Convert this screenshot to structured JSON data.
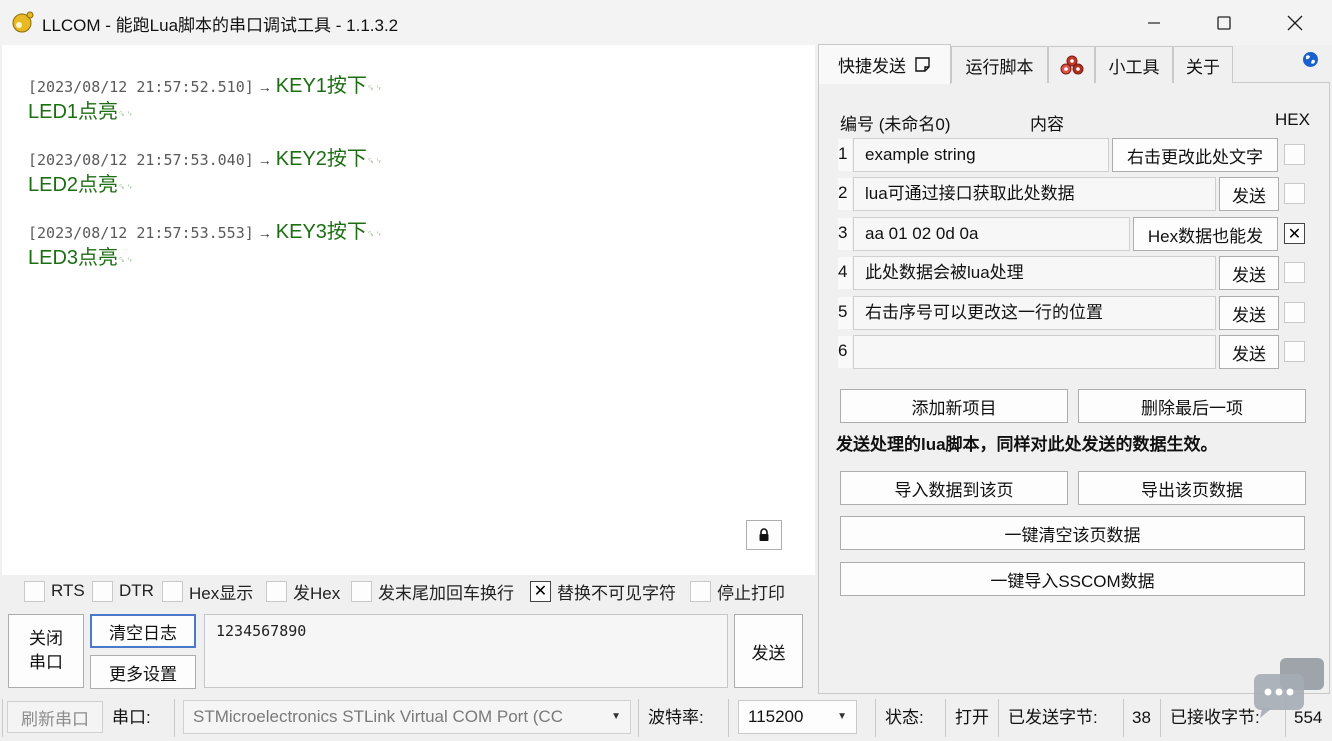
{
  "window": {
    "title": "LLCOM - 能跑Lua脚本的串口调试工具 - 1.1.3.2",
    "minimize_icon": "minimize-icon",
    "maximize_icon": "maximize-icon",
    "close_icon": "close-icon"
  },
  "log": {
    "crlf_marker": "␍␊",
    "arrow": "→",
    "entries": [
      {
        "timestamp": "[2023/08/12 21:57:52.510]",
        "line1": "KEY1按下",
        "line2": "LED1点亮"
      },
      {
        "timestamp": "[2023/08/12 21:57:53.040]",
        "line1": "KEY2按下",
        "line2": "LED2点亮"
      },
      {
        "timestamp": "[2023/08/12 21:57:53.553]",
        "line1": "KEY3按下",
        "line2": "LED3点亮"
      }
    ]
  },
  "options": [
    {
      "label": "RTS",
      "checked": false
    },
    {
      "label": "DTR",
      "checked": false
    },
    {
      "label": "Hex显示",
      "checked": false
    },
    {
      "label": "发Hex",
      "checked": false
    },
    {
      "label": "发末尾加回车换行",
      "checked": false
    },
    {
      "label": "替换不可见字符",
      "checked": true
    },
    {
      "label": "停止打印",
      "checked": false
    }
  ],
  "controls": {
    "close_port": "关闭\n串口",
    "clear_log": "清空日志",
    "more_settings": "更多设置",
    "send_text": "1234567890",
    "send": "发送"
  },
  "tabs": [
    {
      "label": "快捷发送",
      "active": true
    },
    {
      "label": "运行脚本",
      "active": false
    },
    {
      "label": "",
      "icon": "cubes-icon",
      "active": false
    },
    {
      "label": "小工具",
      "active": false
    },
    {
      "label": "关于",
      "active": false
    }
  ],
  "quick_send": {
    "header_num": "编号 (未命名0)",
    "header_content": "内容",
    "header_hex": "HEX",
    "rows": [
      {
        "num": "1",
        "content": "example string",
        "button": "右击更改此处文字",
        "hex": false
      },
      {
        "num": "2",
        "content": "lua可通过接口获取此处数据",
        "button": "发送",
        "hex": false
      },
      {
        "num": "3",
        "content": "aa 01 02 0d 0a",
        "button": "Hex数据也能发",
        "hex": true
      },
      {
        "num": "4",
        "content": "此处数据会被lua处理",
        "button": "发送",
        "hex": false
      },
      {
        "num": "5",
        "content": "右击序号可以更改这一行的位置",
        "button": "发送",
        "hex": false
      },
      {
        "num": "6",
        "content": "",
        "button": "发送",
        "hex": false
      }
    ],
    "add_item": "添加新项目",
    "delete_last": "删除最后一项",
    "note": "发送处理的lua脚本，同样对此处发送的数据生效。",
    "import_data": "导入数据到该页",
    "export_data": "导出该页数据",
    "clear_page": "一键清空该页数据",
    "import_sscom": "一键导入SSCOM数据"
  },
  "statusbar": {
    "refresh": "刷新串口",
    "port_label": "串口:",
    "port_value": "STMicroelectronics STLink Virtual COM Port (CC",
    "baud_label": "波特率:",
    "baud_value": "115200",
    "state_label": "状态:",
    "state_value": "打开",
    "sent_label": "已发送字节:",
    "sent_value": "38",
    "recv_label": "已接收字节:",
    "recv_value": "554"
  },
  "colors": {
    "log_message": "#1c6e12",
    "focus_border": "#4a79c9",
    "globe": "#1a5fd0",
    "cubes": "#c0392b"
  }
}
